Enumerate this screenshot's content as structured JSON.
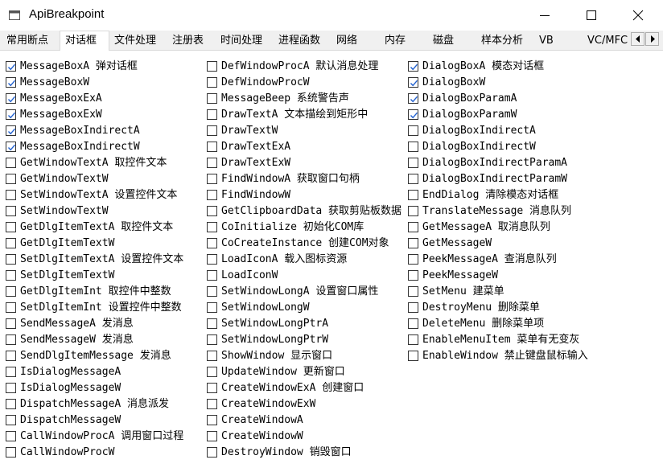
{
  "window": {
    "title": "ApiBreakpoint"
  },
  "tabs": [
    {
      "label": "常用断点",
      "selected": false
    },
    {
      "label": "对话框",
      "selected": true
    },
    {
      "label": "文件处理",
      "selected": false
    },
    {
      "label": "注册表",
      "selected": false
    },
    {
      "label": "时间处理",
      "selected": false
    },
    {
      "label": "进程函数",
      "selected": false
    },
    {
      "label": "网络",
      "selected": false
    },
    {
      "label": "内存",
      "selected": false
    },
    {
      "label": "磁盘",
      "selected": false
    },
    {
      "label": "样本分析",
      "selected": false
    },
    {
      "label": "VB",
      "selected": false
    },
    {
      "label": "VC/MFC",
      "selected": false
    }
  ],
  "icons": {
    "app": "app-icon",
    "minimize": "minimize-icon",
    "maximize": "maximize-icon",
    "close": "close-icon",
    "scroll_left": "arrow-left-icon",
    "scroll_right": "arrow-right-icon",
    "check": "checkmark-icon"
  },
  "colors": {
    "check": "#2060d0",
    "selected_tab_bg": "#ffffff",
    "window_bg": "#f0f0f0"
  },
  "columns": [
    [
      {
        "label": "MessageBoxA 弹对话框",
        "checked": true
      },
      {
        "label": "MessageBoxW",
        "checked": true
      },
      {
        "label": "MessageBoxExA",
        "checked": true
      },
      {
        "label": "MessageBoxExW",
        "checked": true
      },
      {
        "label": "MessageBoxIndirectA",
        "checked": true
      },
      {
        "label": "MessageBoxIndirectW",
        "checked": true
      },
      {
        "label": "GetWindowTextA 取控件文本",
        "checked": false
      },
      {
        "label": "GetWindowTextW",
        "checked": false
      },
      {
        "label": "SetWindowTextA 设置控件文本",
        "checked": false
      },
      {
        "label": "SetWindowTextW",
        "checked": false
      },
      {
        "label": "GetDlgItemTextA 取控件文本",
        "checked": false
      },
      {
        "label": "GetDlgItemTextW",
        "checked": false
      },
      {
        "label": "SetDlgItemTextA 设置控件文本",
        "checked": false
      },
      {
        "label": "SetDlgItemTextW",
        "checked": false
      },
      {
        "label": "GetDlgItemInt 取控件中整数",
        "checked": false
      },
      {
        "label": "SetDlgItemInt 设置控件中整数",
        "checked": false
      },
      {
        "label": "SendMessageA 发消息",
        "checked": false
      },
      {
        "label": "SendMessageW 发消息",
        "checked": false
      },
      {
        "label": "SendDlgItemMessage 发消息",
        "checked": false
      },
      {
        "label": "IsDialogMessageA",
        "checked": false
      },
      {
        "label": "IsDialogMessageW",
        "checked": false
      },
      {
        "label": "DispatchMessageA 消息派发",
        "checked": false
      },
      {
        "label": "DispatchMessageW",
        "checked": false
      },
      {
        "label": "CallWindowProcA 调用窗口过程",
        "checked": false
      },
      {
        "label": "CallWindowProcW",
        "checked": false
      }
    ],
    [
      {
        "label": "DefWindowProcA 默认消息处理",
        "checked": false
      },
      {
        "label": "DefWindowProcW",
        "checked": false
      },
      {
        "label": "MessageBeep 系统警告声",
        "checked": false
      },
      {
        "label": "DrawTextA 文本描绘到矩形中",
        "checked": false
      },
      {
        "label": "DrawTextW",
        "checked": false
      },
      {
        "label": "DrawTextExA",
        "checked": false
      },
      {
        "label": "DrawTextExW",
        "checked": false
      },
      {
        "label": "FindWindowA 获取窗口句柄",
        "checked": false
      },
      {
        "label": "FindWindowW",
        "checked": false
      },
      {
        "label": "GetClipboardData 获取剪贴板数据",
        "checked": false
      },
      {
        "label": "CoInitialize 初始化COM库",
        "checked": false
      },
      {
        "label": "CoCreateInstance 创建COM对象",
        "checked": false
      },
      {
        "label": "LoadIconA 载入图标资源",
        "checked": false
      },
      {
        "label": "LoadIconW",
        "checked": false
      },
      {
        "label": "SetWindowLongA 设置窗口属性",
        "checked": false
      },
      {
        "label": "SetWindowLongW",
        "checked": false
      },
      {
        "label": "SetWindowLongPtrA",
        "checked": false
      },
      {
        "label": "SetWindowLongPtrW",
        "checked": false
      },
      {
        "label": "ShowWindow 显示窗口",
        "checked": false
      },
      {
        "label": "UpdateWindow 更新窗口",
        "checked": false
      },
      {
        "label": "CreateWindowExA 创建窗口",
        "checked": false
      },
      {
        "label": "CreateWindowExW",
        "checked": false
      },
      {
        "label": "CreateWindowA",
        "checked": false
      },
      {
        "label": "CreateWindowW",
        "checked": false
      },
      {
        "label": "DestroyWindow 销毁窗口",
        "checked": false
      }
    ],
    [
      {
        "label": "DialogBoxA 模态对话框",
        "checked": true
      },
      {
        "label": "DialogBoxW",
        "checked": true
      },
      {
        "label": "DialogBoxParamA",
        "checked": true
      },
      {
        "label": "DialogBoxParamW",
        "checked": true
      },
      {
        "label": "DialogBoxIndirectA",
        "checked": false
      },
      {
        "label": "DialogBoxIndirectW",
        "checked": false
      },
      {
        "label": "DialogBoxIndirectParamA",
        "checked": false
      },
      {
        "label": "DialogBoxIndirectParamW",
        "checked": false
      },
      {
        "label": "EndDialog 清除模态对话框",
        "checked": false
      },
      {
        "label": "TranslateMessage 消息队列",
        "checked": false
      },
      {
        "label": "GetMessageA 取消息队列",
        "checked": false
      },
      {
        "label": "GetMessageW",
        "checked": false
      },
      {
        "label": "PeekMessageA 查消息队列",
        "checked": false
      },
      {
        "label": "PeekMessageW",
        "checked": false
      },
      {
        "label": "SetMenu 建菜单",
        "checked": false
      },
      {
        "label": "DestroyMenu 删除菜单",
        "checked": false
      },
      {
        "label": "DeleteMenu 删除菜单项",
        "checked": false
      },
      {
        "label": "EnableMenuItem 菜单有无变灰",
        "checked": false
      },
      {
        "label": "EnableWindow 禁止键盘鼠标输入",
        "checked": false
      }
    ]
  ]
}
